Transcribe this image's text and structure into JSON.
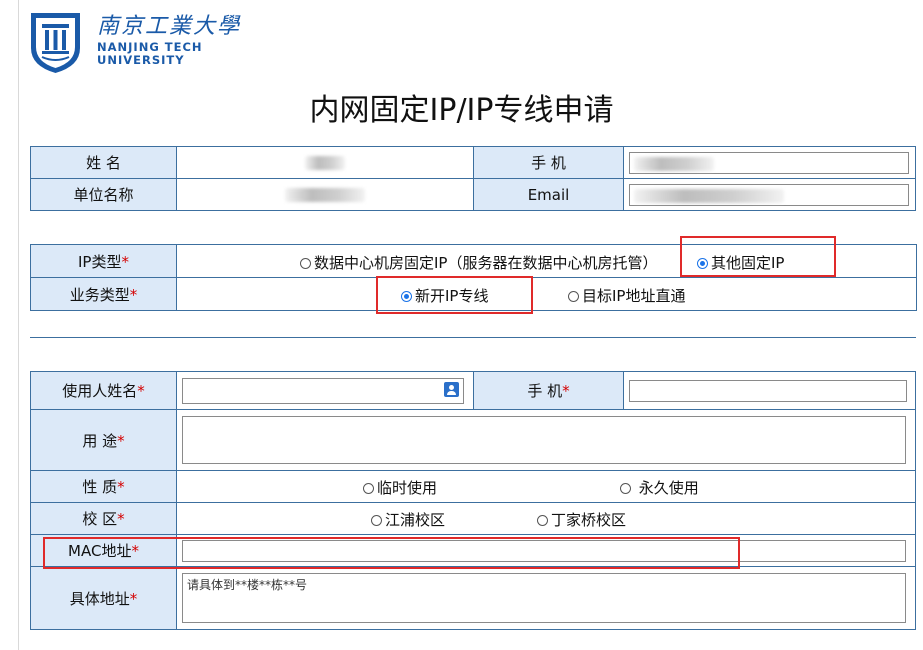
{
  "logo": {
    "name_cn": "南京工業大學",
    "name_en_line1": "NANJING TECH",
    "name_en_line2": "UNIVERSITY"
  },
  "page_title": "内网固定IP/IP专线申请",
  "applicant": {
    "name_label": "姓 名",
    "phone_label": "手 机",
    "unit_label": "单位名称",
    "email_label": "Email"
  },
  "ip_section": {
    "ip_type_label": "IP类型",
    "ip_type_options": [
      "数据中心机房固定IP（服务器在数据中心机房托管）",
      "其他固定IP"
    ],
    "ip_type_selected": "其他固定IP",
    "biz_type_label": "业务类型",
    "biz_type_options": [
      "新开IP专线",
      "目标IP地址直通"
    ],
    "biz_type_selected": "新开IP专线"
  },
  "user_section": {
    "user_name_label": "使用人姓名",
    "user_phone_label": "手 机",
    "purpose_label": "用 途",
    "nature_label": "性 质",
    "nature_options": [
      "临时使用",
      " 永久使用"
    ],
    "campus_label": "校 区",
    "campus_options": [
      "江浦校区",
      "丁家桥校区"
    ],
    "mac_label": "MAC地址",
    "address_label": "具体地址",
    "address_placeholder": "请具体到**楼**栋**号"
  },
  "required_mark": "*",
  "colors": {
    "label_bg": "#dce9f8",
    "border": "#3c6f9f",
    "required": "#d40000",
    "highlight_box": "#e02a2a",
    "brand": "#1a5aa8"
  }
}
